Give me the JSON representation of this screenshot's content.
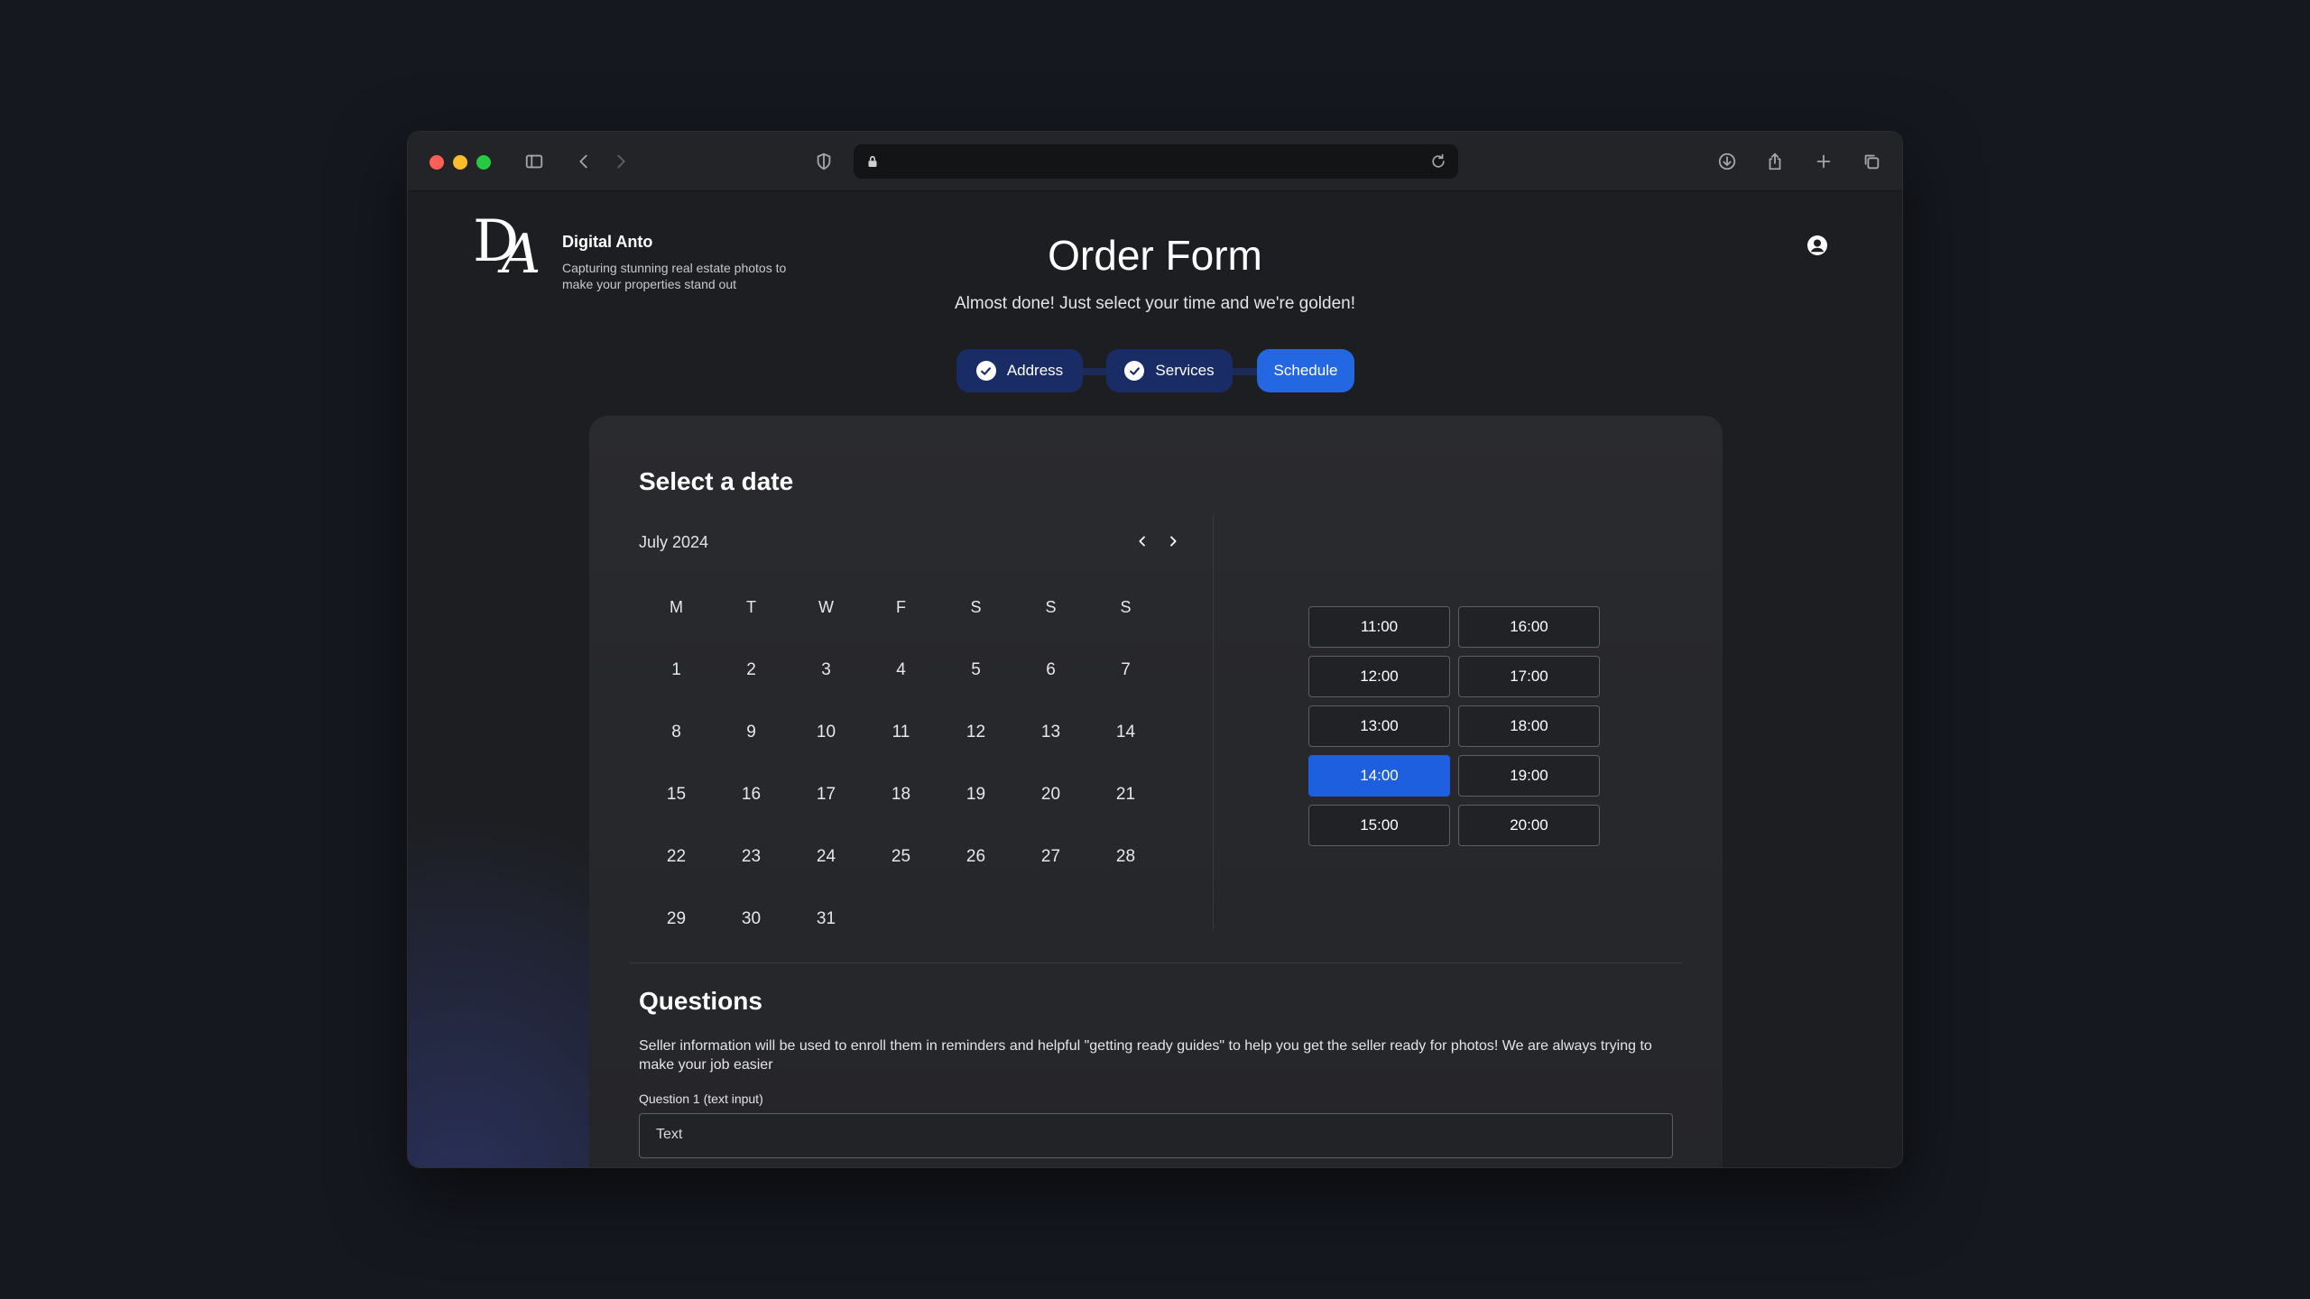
{
  "brand": {
    "name": "Digital Anto",
    "tagline": "Capturing stunning real estate photos to make your properties stand out",
    "logo_letters": "DA"
  },
  "header": {
    "title": "Order Form",
    "subtitle": "Almost done! Just select your time and we're golden!"
  },
  "steps": [
    {
      "label": "Address",
      "completed": true
    },
    {
      "label": "Services",
      "completed": true
    },
    {
      "label": "Schedule",
      "completed": false,
      "active": true
    }
  ],
  "schedule": {
    "heading": "Select a date",
    "month_label": "July 2024",
    "weekdays": [
      "M",
      "T",
      "W",
      "F",
      "S",
      "S",
      "S"
    ],
    "days": [
      "1",
      "2",
      "3",
      "4",
      "5",
      "6",
      "7",
      "8",
      "9",
      "10",
      "11",
      "12",
      "13",
      "14",
      "15",
      "16",
      "17",
      "18",
      "19",
      "20",
      "21",
      "22",
      "23",
      "24",
      "25",
      "26",
      "27",
      "28",
      "29",
      "30",
      "31"
    ],
    "times": [
      "11:00",
      "16:00",
      "12:00",
      "17:00",
      "13:00",
      "18:00",
      "14:00",
      "19:00",
      "15:00",
      "20:00"
    ],
    "selected_time": "14:00"
  },
  "questions": {
    "heading": "Questions",
    "description": "Seller information will be used to enroll them in reminders and helpful \"getting ready guides\" to help you get the seller ready for photos! We are always trying to make your job easier",
    "q1_label": "Question 1 (text input)",
    "q1_placeholder": "Text"
  },
  "colors": {
    "accent": "#1e5fe0",
    "step_completed": "#1a2c66",
    "step_active": "#2467e3",
    "background": "#15181f"
  }
}
